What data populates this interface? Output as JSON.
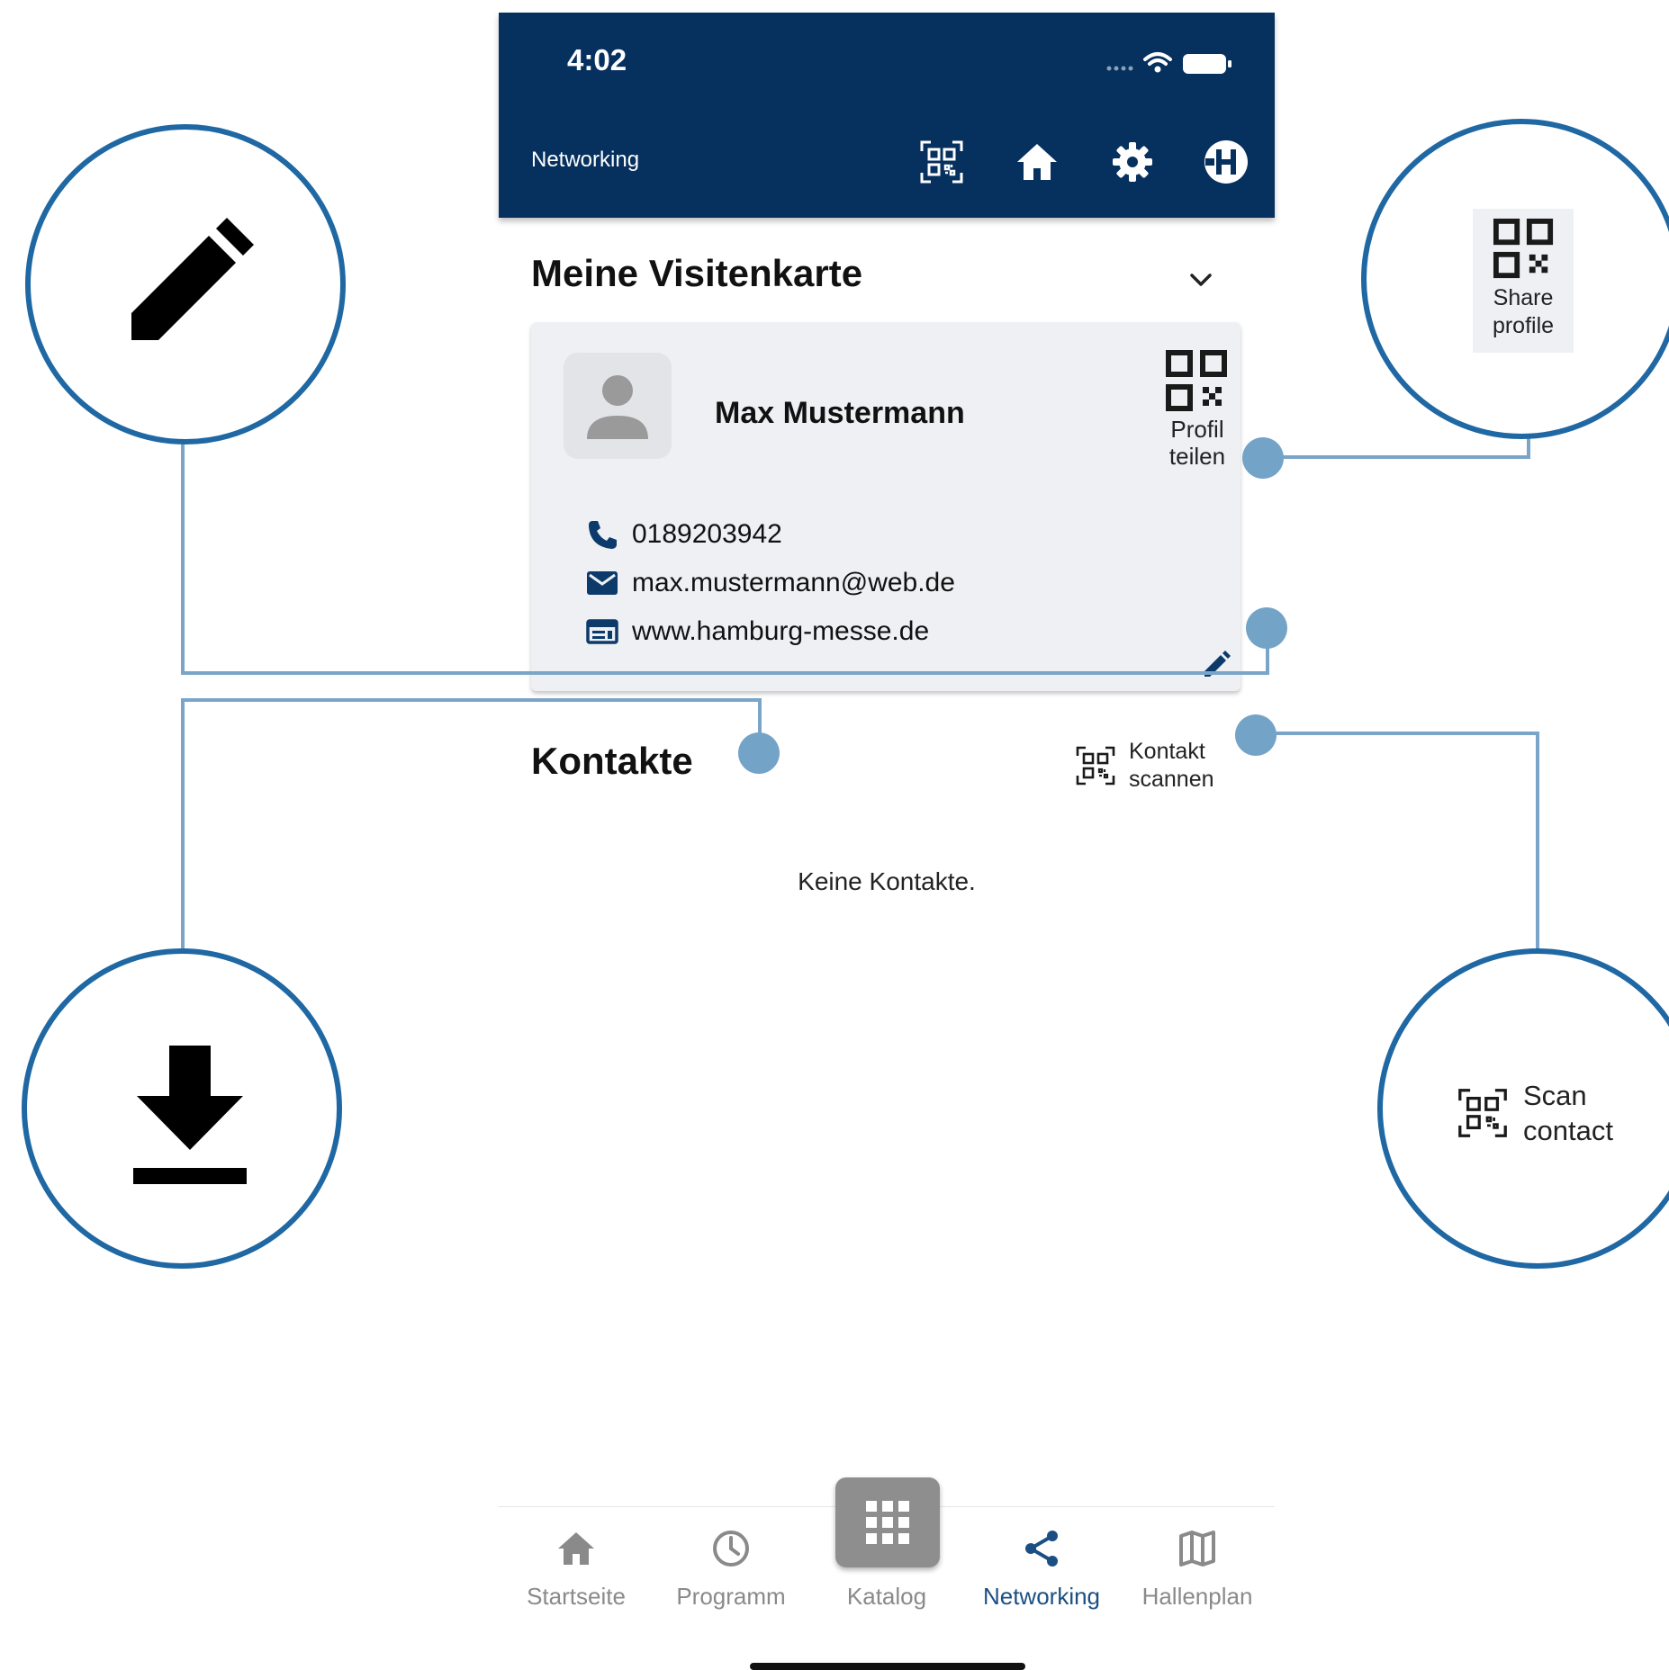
{
  "status_bar": {
    "time": "4:02"
  },
  "app_bar": {
    "title": "Networking",
    "icons": [
      "qr-scan-icon",
      "home-icon",
      "gear-icon",
      "logo-icon"
    ]
  },
  "business_card_section": {
    "title": "Meine Visitenkarte",
    "name": "Max Mustermann",
    "share_label": "Profil\nteilen",
    "phone": "0189203942",
    "email": "max.mustermann@web.de",
    "website": "www.hamburg-messe.de"
  },
  "contacts_section": {
    "title": "Kontakte",
    "scan_label": "Kontakt\nscannen",
    "empty_text": "Keine Kontakte."
  },
  "bottom_nav": {
    "items": [
      {
        "label": "Startseite",
        "icon": "home-icon"
      },
      {
        "label": "Programm",
        "icon": "clock-icon"
      },
      {
        "label": "Katalog",
        "icon": "grid-icon"
      },
      {
        "label": "Networking",
        "icon": "share-icon",
        "active": true
      },
      {
        "label": "Hallenplan",
        "icon": "map-icon"
      }
    ]
  },
  "callouts": {
    "share_profile": "Share\nprofile",
    "scan_contact": "Scan\ncontact"
  },
  "colors": {
    "primary": "#06305e",
    "callout_ring": "#1f68a3",
    "connector": "#7aa5c9",
    "active_nav": "#1b4f83"
  }
}
